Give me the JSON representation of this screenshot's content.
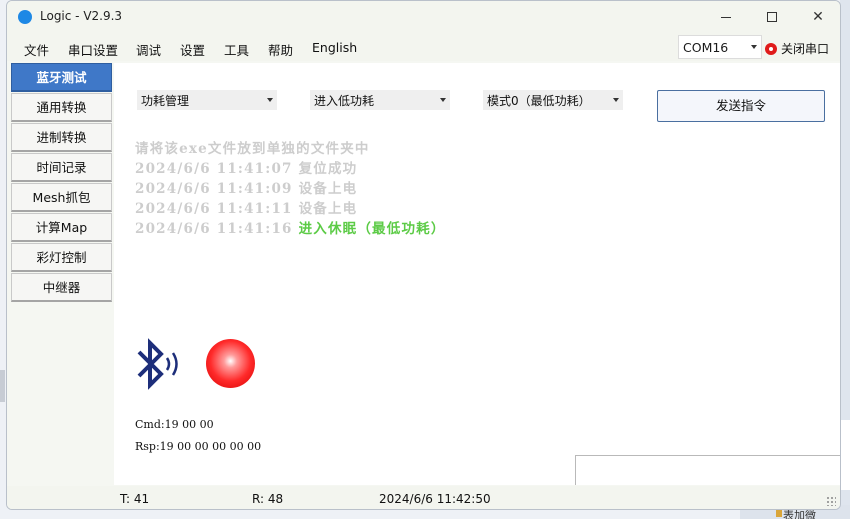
{
  "window": {
    "title": "Logic - V2.9.3"
  },
  "menu": [
    "文件",
    "串口设置",
    "调试",
    "设置",
    "工具",
    "帮助",
    "English"
  ],
  "port": {
    "selected": "COM16",
    "close_label": "关闭串口"
  },
  "sidebar": {
    "items": [
      {
        "label": "蓝牙测试",
        "active": true
      },
      {
        "label": "通用转换"
      },
      {
        "label": "进制转换"
      },
      {
        "label": "时间记录"
      },
      {
        "label": "Mesh抓包"
      },
      {
        "label": "计算Map"
      },
      {
        "label": "彩灯控制"
      },
      {
        "label": "中继器"
      }
    ]
  },
  "controls": {
    "dropdown1": "功耗管理",
    "dropdown2": "进入低功耗",
    "dropdown3": "模式0（最低功耗）",
    "send_label": "发送指令"
  },
  "log": {
    "notice": "请将该exe文件放到单独的文件夹中",
    "entries": [
      {
        "time": "2024/6/6 11:41:07",
        "msg": "复位成功"
      },
      {
        "time": "2024/6/6 11:41:09",
        "msg": "设备上电"
      },
      {
        "time": "2024/6/6 11:41:11",
        "msg": "设备上电"
      },
      {
        "time": "2024/6/6 11:41:16",
        "msg": "进入休眠（最低功耗）"
      }
    ]
  },
  "io": {
    "cmd": "Cmd:19 00 00",
    "rsp": "Rsp:19 00 00 00 00 00"
  },
  "status": {
    "tx": "T: 41",
    "rx": "R: 48",
    "datetime": "2024/6/6 11:42:50"
  },
  "desktop": {
    "partial_text": "表加微"
  },
  "colors": {
    "accent": "#3f78c8",
    "log_gray": "#cdcdcd",
    "log_green": "#5ccb46",
    "status_red": "#e01b1b",
    "bt_navy": "#1d2e7a"
  },
  "icons": {
    "app": "app-logo-icon",
    "bluetooth": "bluetooth-signal-icon",
    "led": "red-led-icon"
  }
}
